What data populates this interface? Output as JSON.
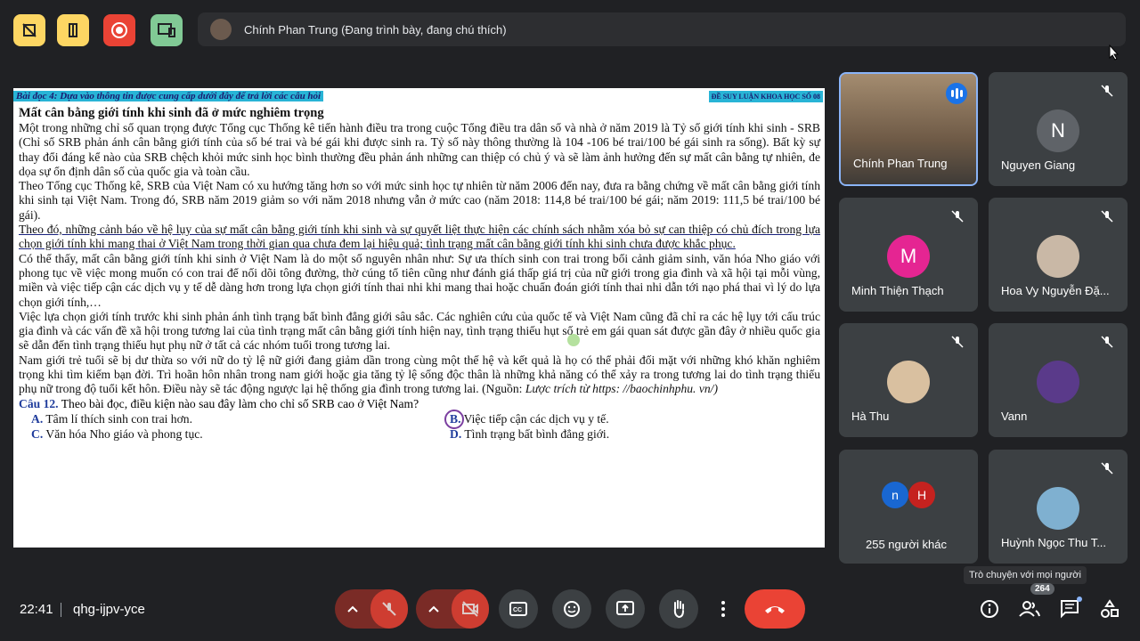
{
  "presenter": {
    "label": "Chính Phan Trung (Đang trình bày, đang chú thích)"
  },
  "document": {
    "header_left": "Bài đọc 4: Dựa vào thông tin được cung cấp dưới đây để trả lời các câu hỏi",
    "header_right": "ĐỀ SUY LUẬN KHOA HỌC SỐ 08",
    "title": "Mất cân bằng giới tính khi sinh đã ở mức nghiêm trọng",
    "p1": " Một trong những chỉ số quan trọng được Tổng cục Thống kê tiến hành điều tra trong cuộc Tổng điều tra dân số và nhà ở năm 2019 là Tỷ số giới tính khi sinh - SRB (Chỉ số SRB phản ánh cân bằng giới tính của số bé trai và bé gái khi được sinh ra. Tỷ số này thông thường là 104 -106 bé trai/100 bé gái sinh ra sống). Bất kỳ sự thay đổi đáng kể nào của SRB chệch khỏi mức sinh học bình thường đều phản ánh những can thiệp có chủ ý và sẽ làm ảnh hưởng đến sự mất cân bằng tự nhiên, đe dọa sự ổn định dân số của quốc gia và toàn cầu.",
    "p2": "Theo Tổng cục Thống kê, SRB của Việt Nam có xu hướng tăng hơn so với mức sinh học tự nhiên từ năm 2006 đến nay, đưa ra bằng chứng về mất cân bằng giới tính khi sinh tại Việt Nam. Trong đó, SRB năm 2019 giảm so với năm 2018 nhưng vẫn ở mức cao (năm 2018: 114,8 bé trai/100 bé gái; năm 2019: 111,5 bé trai/100 bé gái).",
    "p3": " Theo đó, những cảnh báo về hệ lụy của sự mất cân bằng giới tính khi sinh và sự quyết liệt thực hiện các chính sách nhằm xóa bỏ sự can thiệp có chủ đích trong lựa chọn giới tính khi mang thai ở Việt Nam trong thời gian qua chưa đem lại hiệu quả; tình trạng mất cân bằng giới tính khi sinh chưa được khắc phục.",
    "p4": " Có thể thấy, mất cân bằng giới tính khi sinh ở Việt Nam là do một số nguyên nhân như: Sự ưa thích sinh con trai trong bối cảnh giảm sinh, văn hóa Nho giáo với phong tục về việc mong muốn có con trai để nối dõi tông đường, thờ cúng tổ tiên cũng như đánh giá thấp giá trị của nữ giới trong gia đình và xã hội tại mỗi vùng, miền và việc tiếp cận các dịch vụ y tế dễ dàng hơn trong lựa chọn giới tính thai nhi khi mang thai hoặc chuẩn đoán giới tính thai nhi dẫn tới nạo phá thai vì lý do lựa chọn giới tính,…",
    "p5": "Việc lựa chọn giới tính trước khi sinh phản ánh tình trạng bất bình đẳng giới sâu sắc. Các nghiên cứu của quốc tế và Việt Nam cũng đã chỉ ra các hệ lụy tới cấu trúc gia đình và các vấn đề xã hội trong tương lai của tình trạng mất cân bằng giới tính hiện nay, tình trạng thiếu hụt số trẻ em gái quan sát được gần đây ở nhiều quốc gia sẽ dẫn đến tình trạng thiếu hụt phụ nữ ở tất cả các nhóm tuổi trong tương lai.",
    "p6": " Nam giới trẻ tuổi sẽ bị dư thừa so với nữ do tỷ lệ nữ giới đang giảm dần trong cùng một thế hệ và kết quả là họ có thể phải đối mặt với những khó khăn nghiêm trọng khi tìm kiếm bạn đời. Trì hoãn hôn nhân trong nam giới hoặc gia tăng tỷ lệ sống độc thân là những khả năng có thể xảy ra trong tương lai do tình trạng thiếu phụ nữ trong độ tuổi kết hôn. Điều này sẽ tác động ngược lại hệ thống gia đình trong tương lai. (Nguồn: ",
    "p6_source": "Lược trích từ https: //baochinhphu. vn/)",
    "q_num": "Câu 12.",
    "q_text": " Theo bài đọc, điều kiện nào sau đây làm cho chỉ số SRB cao ở Việt Nam?",
    "opt_a_key": "A.",
    "opt_a": " Tâm lí thích sinh con trai hơn.",
    "opt_b_key": "B.",
    "opt_b": " Việc tiếp cận các dịch vụ y tế.",
    "opt_c_key": "C.",
    "opt_c": " Văn hóa Nho giáo và phong tục.",
    "opt_d_key": "D.",
    "opt_d": " Tình trạng bất bình đẳng giới."
  },
  "participants": [
    {
      "name": "Chính Phan Trung",
      "initial": "",
      "color": "#7a6a5a"
    },
    {
      "name": "Nguyen Giang",
      "initial": "N",
      "color": "#5f6368"
    },
    {
      "name": "Minh Thiện Thạch",
      "initial": "M",
      "color": "#e52592"
    },
    {
      "name": "Hoa Vy Nguyễn Đặ...",
      "initial": "",
      "color": "#c9b8a6"
    },
    {
      "name": "Hà Thu",
      "initial": "",
      "color": "#d9c0a0"
    },
    {
      "name": "Vann",
      "initial": "",
      "color": "#5a3a8a"
    },
    {
      "name": "255 người khác",
      "initial_1": "n",
      "initial_2": "H",
      "color_1": "#1967d2",
      "color_2": "#c5221f"
    },
    {
      "name": "Huỳnh Ngọc Thu T...",
      "initial": "",
      "color": "#7fb0d0"
    }
  ],
  "bottom": {
    "time": "22:41",
    "meeting_code": "qhg-ijpv-yce",
    "chat_tooltip": "Trò chuyện với mọi người",
    "participant_count": "264"
  },
  "colors": {
    "accent_blue": "#8ab4f8",
    "mic_off_red": "#ea4335",
    "end_call": "#ea4335",
    "top_yellow": "#fdd663",
    "top_red": "#ea4335",
    "top_green": "#81c995"
  }
}
